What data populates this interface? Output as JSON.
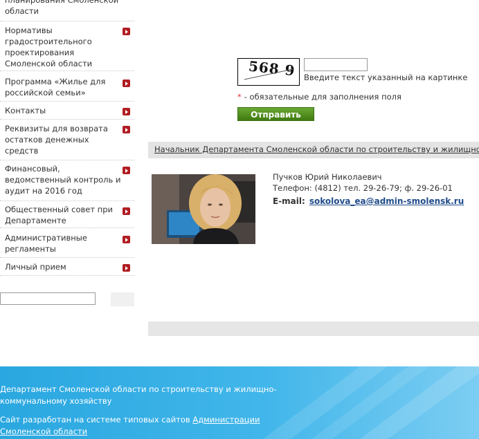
{
  "sidebar": {
    "items": [
      {
        "label": "планирования Смоленской\nобласти"
      },
      {
        "label": "Нормативы\nградостроительного\nпроектирования\nСмоленской области"
      },
      {
        "label": "Программа «Жилье для\nроссийской семьи»"
      },
      {
        "label": "Контакты"
      },
      {
        "label": "Реквизиты для возврата\nостатков денежных\nсредств"
      },
      {
        "label": "Финансовый,\nведомственный контроль и\nаудит на 2016 год"
      },
      {
        "label": "Общественный совет при\nДепартаменте"
      },
      {
        "label": "Административные\nрегламенты"
      },
      {
        "label": "Личный прием"
      }
    ],
    "search_value": ""
  },
  "form": {
    "captcha_text": "568 9",
    "captcha_input_value": "",
    "captcha_hint": "Введите текст указанный на картинке",
    "required_star": "*",
    "required_note": "- обязательные для заполнения поля",
    "submit_label": "Отправить"
  },
  "contact": {
    "header_link": "Начальник Департамента Смоленской области по строительству и жилищно - коммунальному хозяйству",
    "name": "Пучков Юрий Николаевич",
    "phone": "Телефон: (4812)  тел. 29-26-79; ф. 29-26-01",
    "email_label": "E-mail:",
    "email": "sokolova_ea@admin-smolensk.ru"
  },
  "footer": {
    "line1": "Департамент Смоленской области по строительству и жилищно-коммунальному хозяйству",
    "line2_prefix": "Сайт разработан на системе типовых сайтов ",
    "line2_link": "Администрации Смоленской области"
  },
  "colors": {
    "arrow": "#b01d22",
    "submit": "#4c8b1a",
    "footer": "#2aa7e0",
    "link": "#1f4b8a"
  }
}
